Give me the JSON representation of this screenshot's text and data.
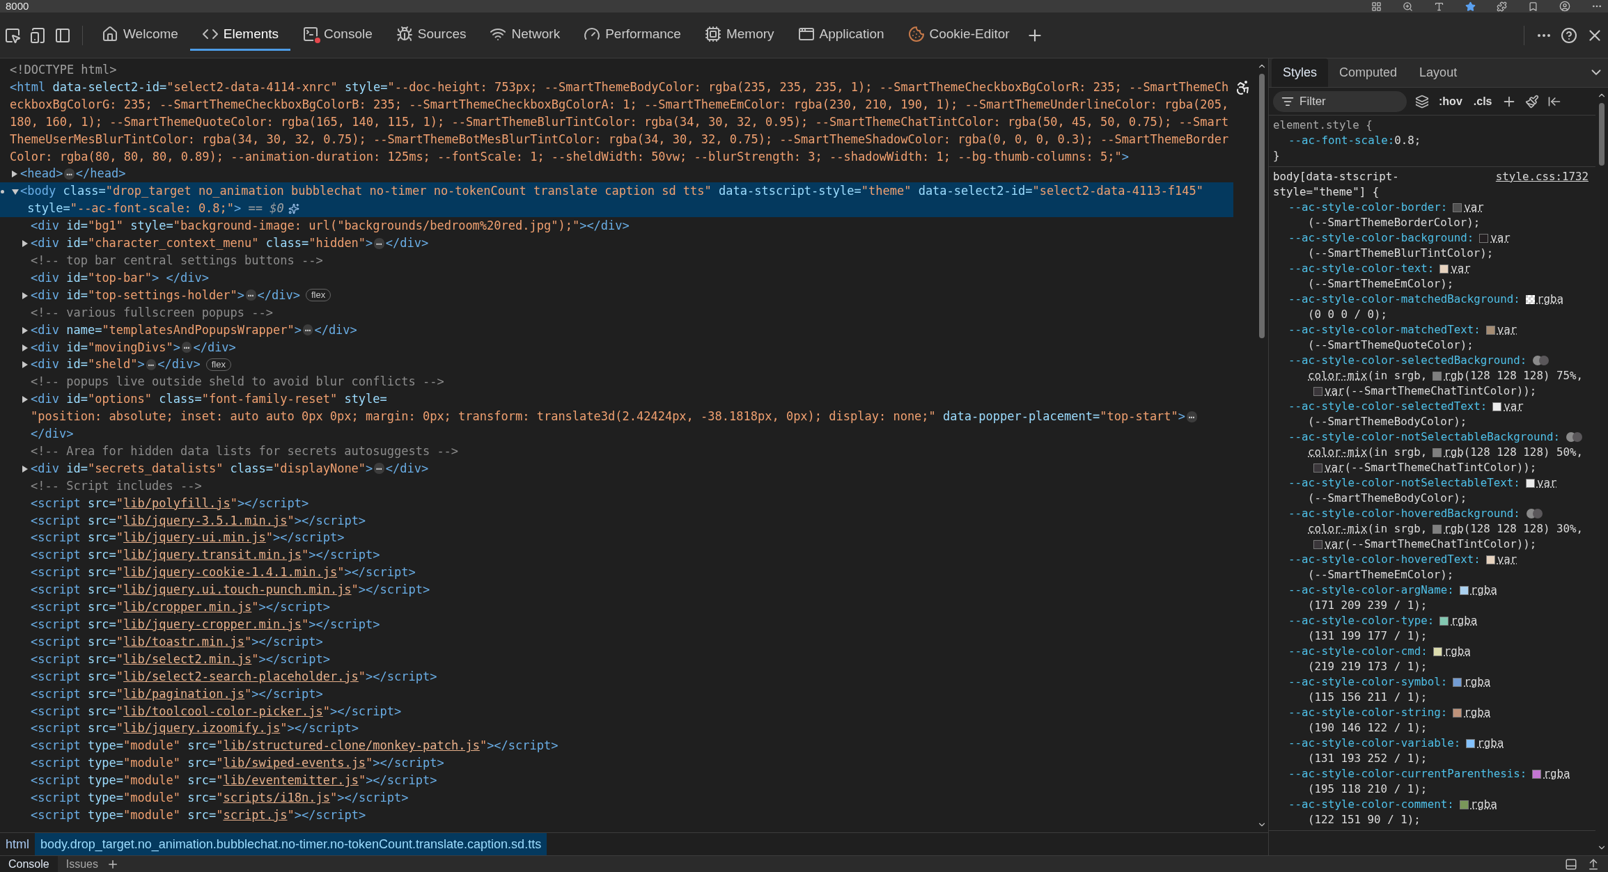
{
  "address_bar": {
    "text": "8000"
  },
  "devtools_tabs": [
    {
      "label": "Welcome",
      "selected": false,
      "has_errors": false
    },
    {
      "label": "Elements",
      "selected": true,
      "has_errors": false
    },
    {
      "label": "Console",
      "selected": false,
      "has_errors": true
    },
    {
      "label": "Sources",
      "selected": false,
      "has_errors": false
    },
    {
      "label": "Network",
      "selected": false,
      "has_errors": false
    },
    {
      "label": "Performance",
      "selected": false,
      "has_errors": false
    },
    {
      "label": "Memory",
      "selected": false,
      "has_errors": false
    },
    {
      "label": "Application",
      "selected": false,
      "has_errors": false
    },
    {
      "label": "Cookie-Editor",
      "selected": false,
      "has_errors": false
    }
  ],
  "dom_tree": [
    {
      "selected": false,
      "parts": [
        {
          "kind": "doctype",
          "text": "<!DOCTYPE html>"
        }
      ]
    },
    {
      "selected": false,
      "parts": [
        {
          "kind": "tag",
          "text": "<html"
        },
        {
          "kind": "attr",
          "text": " data-select2-id="
        },
        {
          "kind": "val",
          "text": "\"select2-data-4114-xnrc\""
        },
        {
          "kind": "attr",
          "text": " style="
        },
        {
          "kind": "val",
          "text": "\"--doc-height: 753px; --SmartThemeBodyColor: rgba(235, 235, 235, 1); --SmartThemeCheckboxBgColorR: 235; --SmartThemeCheckboxBgColorG: 235; --SmartThemeCheckboxBgColorB: 235; --SmartThemeCheckboxBgColorA: 1; --SmartThemeEmColor: rgba(230, 210, 190, 1); --SmartThemeUnderlineColor: rgba(205, 180, 160, 1); --SmartThemeQuoteColor: rgba(165, 140, 115, 1); --SmartThemeBlurTintColor: rgba(34, 30, 32, 0.95); --SmartThemeChatTintColor: rgba(50, 45, 50, 0.75); --SmartThemeUserMesBlurTintColor: rgba(34, 30, 32, 0.75); --SmartThemeBotMesBlurTintColor: rgba(34, 30, 32, 0.75); --SmartThemeShadowColor: rgba(0, 0, 0, 0.3); --SmartThemeBorderColor: rgba(80, 80, 80, 0.89); --animation-duration: 125ms; --fontScale: 1; --sheldWidth: 50vw; --blurStrength: 3; --shadowWidth: 1; --bg-thumb-columns: 5;\""
        },
        {
          "kind": "tag",
          "text": ">"
        }
      ],
      "children": [
        {
          "selected": false,
          "expanded": false,
          "parts": [
            {
              "kind": "tag",
              "text": "<head>"
            },
            {
              "kind": "more",
              "text": "⋯"
            },
            {
              "kind": "tag",
              "text": "</head>"
            }
          ]
        },
        {
          "selected": true,
          "expanded": true,
          "parts": [
            {
              "kind": "tag",
              "text": "<body"
            },
            {
              "kind": "attr",
              "text": " class="
            },
            {
              "kind": "val",
              "text": "\"drop_target no_animation bubblechat no-timer no-tokenCount translate caption sd tts\""
            },
            {
              "kind": "attr",
              "text": " data-stscript-style="
            },
            {
              "kind": "val",
              "text": "\"theme\""
            },
            {
              "kind": "attr",
              "text": " data-select2-id="
            },
            {
              "kind": "val",
              "text": "\"select2-data-4113-f145\""
            },
            {
              "kind": "attr",
              "text": " style="
            },
            {
              "kind": "val",
              "text": "\"--ac-font-scale: 0.8;\""
            },
            {
              "kind": "tag",
              "text": ">"
            },
            {
              "kind": "hint",
              "text": " == $0"
            }
          ],
          "children": [
            {
              "selected": false,
              "parts": [
                {
                  "kind": "tag",
                  "text": "<div"
                },
                {
                  "kind": "attr",
                  "text": " id="
                },
                {
                  "kind": "val",
                  "text": "\"bg1\""
                },
                {
                  "kind": "attr",
                  "text": " style="
                },
                {
                  "kind": "val",
                  "text": "\"background-image: url(\"backgrounds/bedroom%20red.jpg\");\""
                },
                {
                  "kind": "tag",
                  "text": "></div>"
                }
              ]
            },
            {
              "selected": false,
              "expanded": false,
              "parts": [
                {
                  "kind": "tag",
                  "text": "<div"
                },
                {
                  "kind": "attr",
                  "text": " id="
                },
                {
                  "kind": "val",
                  "text": "\"character_context_menu\""
                },
                {
                  "kind": "attr",
                  "text": " class="
                },
                {
                  "kind": "val",
                  "text": "\"hidden\""
                },
                {
                  "kind": "tag",
                  "text": ">"
                },
                {
                  "kind": "more",
                  "text": "⋯"
                },
                {
                  "kind": "tag",
                  "text": "</div>"
                }
              ]
            },
            {
              "selected": false,
              "parts": [
                {
                  "kind": "comment",
                  "text": "<!-- top bar central settings buttons -->"
                }
              ]
            },
            {
              "selected": false,
              "parts": [
                {
                  "kind": "tag",
                  "text": "<div"
                },
                {
                  "kind": "attr",
                  "text": " id="
                },
                {
                  "kind": "val",
                  "text": "\"top-bar\""
                },
                {
                  "kind": "tag",
                  "text": "> </div>"
                }
              ]
            },
            {
              "selected": false,
              "expanded": false,
              "parts": [
                {
                  "kind": "tag",
                  "text": "<div"
                },
                {
                  "kind": "attr",
                  "text": " id="
                },
                {
                  "kind": "val",
                  "text": "\"top-settings-holder\""
                },
                {
                  "kind": "tag",
                  "text": ">"
                },
                {
                  "kind": "more",
                  "text": "⋯"
                },
                {
                  "kind": "tag",
                  "text": "</div>"
                },
                {
                  "kind": "badge",
                  "text": "flex"
                }
              ]
            },
            {
              "selected": false,
              "parts": [
                {
                  "kind": "comment",
                  "text": "<!-- various fullscreen popups -->"
                }
              ]
            },
            {
              "selected": false,
              "expanded": false,
              "parts": [
                {
                  "kind": "tag",
                  "text": "<div"
                },
                {
                  "kind": "attr",
                  "text": " name="
                },
                {
                  "kind": "val",
                  "text": "\"templatesAndPopupsWrapper\""
                },
                {
                  "kind": "tag",
                  "text": ">"
                },
                {
                  "kind": "more",
                  "text": "⋯"
                },
                {
                  "kind": "tag",
                  "text": "</div>"
                }
              ]
            },
            {
              "selected": false,
              "expanded": false,
              "parts": [
                {
                  "kind": "tag",
                  "text": "<div"
                },
                {
                  "kind": "attr",
                  "text": " id="
                },
                {
                  "kind": "val",
                  "text": "\"movingDivs\""
                },
                {
                  "kind": "tag",
                  "text": ">"
                },
                {
                  "kind": "more",
                  "text": "⋯"
                },
                {
                  "kind": "tag",
                  "text": "</div>"
                }
              ]
            },
            {
              "selected": false,
              "expanded": false,
              "parts": [
                {
                  "kind": "tag",
                  "text": "<div"
                },
                {
                  "kind": "attr",
                  "text": " id="
                },
                {
                  "kind": "val",
                  "text": "\"sheld\""
                },
                {
                  "kind": "tag",
                  "text": ">"
                },
                {
                  "kind": "more",
                  "text": "⋯"
                },
                {
                  "kind": "tag",
                  "text": "</div>"
                },
                {
                  "kind": "badge",
                  "text": "flex"
                }
              ]
            },
            {
              "selected": false,
              "parts": [
                {
                  "kind": "comment",
                  "text": "<!-- popups live outside sheld to avoid blur conflicts -->"
                }
              ]
            },
            {
              "selected": false,
              "expanded": false,
              "parts": [
                {
                  "kind": "tag",
                  "text": "<div"
                },
                {
                  "kind": "attr",
                  "text": " id="
                },
                {
                  "kind": "val",
                  "text": "\"options\""
                },
                {
                  "kind": "attr",
                  "text": " class="
                },
                {
                  "kind": "val",
                  "text": "\"font-family-reset\""
                },
                {
                  "kind": "attr",
                  "text": " style="
                },
                {
                  "kind": "val",
                  "text": "\"position: absolute; inset: auto auto 0px 0px; margin: 0px; transform: translate3d(2.42424px, -38.1818px, 0px); display: none;\""
                },
                {
                  "kind": "attr",
                  "text": " data-popper-placement="
                },
                {
                  "kind": "val",
                  "text": "\"top-start\""
                },
                {
                  "kind": "tag",
                  "text": ">"
                },
                {
                  "kind": "more",
                  "text": "⋯"
                },
                {
                  "kind": "tag",
                  "text": "</div>"
                }
              ]
            },
            {
              "selected": false,
              "parts": [
                {
                  "kind": "comment",
                  "text": "<!-- Area for hidden data lists for secrets autosuggests -->"
                }
              ]
            },
            {
              "selected": false,
              "expanded": false,
              "parts": [
                {
                  "kind": "tag",
                  "text": "<div"
                },
                {
                  "kind": "attr",
                  "text": " id="
                },
                {
                  "kind": "val",
                  "text": "\"secrets_datalists\""
                },
                {
                  "kind": "attr",
                  "text": " class="
                },
                {
                  "kind": "val",
                  "text": "\"displayNone\""
                },
                {
                  "kind": "tag",
                  "text": ">"
                },
                {
                  "kind": "more",
                  "text": "⋯"
                },
                {
                  "kind": "tag",
                  "text": "</div>"
                }
              ]
            },
            {
              "selected": false,
              "parts": [
                {
                  "kind": "comment",
                  "text": "<!-- Script includes -->"
                }
              ]
            },
            {
              "selected": false,
              "parts": [
                {
                  "kind": "tag",
                  "text": "<script"
                },
                {
                  "kind": "attr",
                  "text": " src="
                },
                {
                  "kind": "val",
                  "text": "\""
                },
                {
                  "kind": "link",
                  "text": "lib/polyfill.js"
                },
                {
                  "kind": "val",
                  "text": "\""
                },
                {
                  "kind": "tag",
                  "text": "></script>"
                }
              ]
            },
            {
              "selected": false,
              "parts": [
                {
                  "kind": "tag",
                  "text": "<script"
                },
                {
                  "kind": "attr",
                  "text": " src="
                },
                {
                  "kind": "val",
                  "text": "\""
                },
                {
                  "kind": "link",
                  "text": "lib/jquery-3.5.1.min.js"
                },
                {
                  "kind": "val",
                  "text": "\""
                },
                {
                  "kind": "tag",
                  "text": "></script>"
                }
              ]
            },
            {
              "selected": false,
              "parts": [
                {
                  "kind": "tag",
                  "text": "<script"
                },
                {
                  "kind": "attr",
                  "text": " src="
                },
                {
                  "kind": "val",
                  "text": "\""
                },
                {
                  "kind": "link",
                  "text": "lib/jquery-ui.min.js"
                },
                {
                  "kind": "val",
                  "text": "\""
                },
                {
                  "kind": "tag",
                  "text": "></script>"
                }
              ]
            },
            {
              "selected": false,
              "parts": [
                {
                  "kind": "tag",
                  "text": "<script"
                },
                {
                  "kind": "attr",
                  "text": " src="
                },
                {
                  "kind": "val",
                  "text": "\""
                },
                {
                  "kind": "link",
                  "text": "lib/jquery.transit.min.js"
                },
                {
                  "kind": "val",
                  "text": "\""
                },
                {
                  "kind": "tag",
                  "text": "></script>"
                }
              ]
            },
            {
              "selected": false,
              "parts": [
                {
                  "kind": "tag",
                  "text": "<script"
                },
                {
                  "kind": "attr",
                  "text": " src="
                },
                {
                  "kind": "val",
                  "text": "\""
                },
                {
                  "kind": "link",
                  "text": "lib/jquery-cookie-1.4.1.min.js"
                },
                {
                  "kind": "val",
                  "text": "\""
                },
                {
                  "kind": "tag",
                  "text": "></script>"
                }
              ]
            },
            {
              "selected": false,
              "parts": [
                {
                  "kind": "tag",
                  "text": "<script"
                },
                {
                  "kind": "attr",
                  "text": " src="
                },
                {
                  "kind": "val",
                  "text": "\""
                },
                {
                  "kind": "link",
                  "text": "lib/jquery.ui.touch-punch.min.js"
                },
                {
                  "kind": "val",
                  "text": "\""
                },
                {
                  "kind": "tag",
                  "text": "></script>"
                }
              ]
            },
            {
              "selected": false,
              "parts": [
                {
                  "kind": "tag",
                  "text": "<script"
                },
                {
                  "kind": "attr",
                  "text": " src="
                },
                {
                  "kind": "val",
                  "text": "\""
                },
                {
                  "kind": "link",
                  "text": "lib/cropper.min.js"
                },
                {
                  "kind": "val",
                  "text": "\""
                },
                {
                  "kind": "tag",
                  "text": "></script>"
                }
              ]
            },
            {
              "selected": false,
              "parts": [
                {
                  "kind": "tag",
                  "text": "<script"
                },
                {
                  "kind": "attr",
                  "text": " src="
                },
                {
                  "kind": "val",
                  "text": "\""
                },
                {
                  "kind": "link",
                  "text": "lib/jquery-cropper.min.js"
                },
                {
                  "kind": "val",
                  "text": "\""
                },
                {
                  "kind": "tag",
                  "text": "></script>"
                }
              ]
            },
            {
              "selected": false,
              "parts": [
                {
                  "kind": "tag",
                  "text": "<script"
                },
                {
                  "kind": "attr",
                  "text": " src="
                },
                {
                  "kind": "val",
                  "text": "\""
                },
                {
                  "kind": "link",
                  "text": "lib/toastr.min.js"
                },
                {
                  "kind": "val",
                  "text": "\""
                },
                {
                  "kind": "tag",
                  "text": "></script>"
                }
              ]
            },
            {
              "selected": false,
              "parts": [
                {
                  "kind": "tag",
                  "text": "<script"
                },
                {
                  "kind": "attr",
                  "text": " src="
                },
                {
                  "kind": "val",
                  "text": "\""
                },
                {
                  "kind": "link",
                  "text": "lib/select2.min.js"
                },
                {
                  "kind": "val",
                  "text": "\""
                },
                {
                  "kind": "tag",
                  "text": "></script>"
                }
              ]
            },
            {
              "selected": false,
              "parts": [
                {
                  "kind": "tag",
                  "text": "<script"
                },
                {
                  "kind": "attr",
                  "text": " src="
                },
                {
                  "kind": "val",
                  "text": "\""
                },
                {
                  "kind": "link",
                  "text": "lib/select2-search-placeholder.js"
                },
                {
                  "kind": "val",
                  "text": "\""
                },
                {
                  "kind": "tag",
                  "text": "></script>"
                }
              ]
            },
            {
              "selected": false,
              "parts": [
                {
                  "kind": "tag",
                  "text": "<script"
                },
                {
                  "kind": "attr",
                  "text": " src="
                },
                {
                  "kind": "val",
                  "text": "\""
                },
                {
                  "kind": "link",
                  "text": "lib/pagination.js"
                },
                {
                  "kind": "val",
                  "text": "\""
                },
                {
                  "kind": "tag",
                  "text": "></script>"
                }
              ]
            },
            {
              "selected": false,
              "parts": [
                {
                  "kind": "tag",
                  "text": "<script"
                },
                {
                  "kind": "attr",
                  "text": " src="
                },
                {
                  "kind": "val",
                  "text": "\""
                },
                {
                  "kind": "link",
                  "text": "lib/toolcool-color-picker.js"
                },
                {
                  "kind": "val",
                  "text": "\""
                },
                {
                  "kind": "tag",
                  "text": "></script>"
                }
              ]
            },
            {
              "selected": false,
              "parts": [
                {
                  "kind": "tag",
                  "text": "<script"
                },
                {
                  "kind": "attr",
                  "text": " src="
                },
                {
                  "kind": "val",
                  "text": "\""
                },
                {
                  "kind": "link",
                  "text": "lib/jquery.izoomify.js"
                },
                {
                  "kind": "val",
                  "text": "\""
                },
                {
                  "kind": "tag",
                  "text": "></script>"
                }
              ]
            },
            {
              "selected": false,
              "parts": [
                {
                  "kind": "tag",
                  "text": "<script"
                },
                {
                  "kind": "attr",
                  "text": " type="
                },
                {
                  "kind": "val",
                  "text": "\"module\""
                },
                {
                  "kind": "attr",
                  "text": " src="
                },
                {
                  "kind": "val",
                  "text": "\""
                },
                {
                  "kind": "link",
                  "text": "lib/structured-clone/monkey-patch.js"
                },
                {
                  "kind": "val",
                  "text": "\""
                },
                {
                  "kind": "tag",
                  "text": "></script>"
                }
              ]
            },
            {
              "selected": false,
              "parts": [
                {
                  "kind": "tag",
                  "text": "<script"
                },
                {
                  "kind": "attr",
                  "text": " type="
                },
                {
                  "kind": "val",
                  "text": "\"module\""
                },
                {
                  "kind": "attr",
                  "text": " src="
                },
                {
                  "kind": "val",
                  "text": "\""
                },
                {
                  "kind": "link",
                  "text": "lib/swiped-events.js"
                },
                {
                  "kind": "val",
                  "text": "\""
                },
                {
                  "kind": "tag",
                  "text": "></script>"
                }
              ]
            },
            {
              "selected": false,
              "parts": [
                {
                  "kind": "tag",
                  "text": "<script"
                },
                {
                  "kind": "attr",
                  "text": " type="
                },
                {
                  "kind": "val",
                  "text": "\"module\""
                },
                {
                  "kind": "attr",
                  "text": " src="
                },
                {
                  "kind": "val",
                  "text": "\""
                },
                {
                  "kind": "link",
                  "text": "lib/eventemitter.js"
                },
                {
                  "kind": "val",
                  "text": "\""
                },
                {
                  "kind": "tag",
                  "text": "></script>"
                }
              ]
            },
            {
              "selected": false,
              "parts": [
                {
                  "kind": "tag",
                  "text": "<script"
                },
                {
                  "kind": "attr",
                  "text": " type="
                },
                {
                  "kind": "val",
                  "text": "\"module\""
                },
                {
                  "kind": "attr",
                  "text": " src="
                },
                {
                  "kind": "val",
                  "text": "\""
                },
                {
                  "kind": "link",
                  "text": "scripts/i18n.js"
                },
                {
                  "kind": "val",
                  "text": "\""
                },
                {
                  "kind": "tag",
                  "text": "></script>"
                }
              ]
            },
            {
              "selected": false,
              "parts": [
                {
                  "kind": "tag",
                  "text": "<script"
                },
                {
                  "kind": "attr",
                  "text": " type="
                },
                {
                  "kind": "val",
                  "text": "\"module\""
                },
                {
                  "kind": "attr",
                  "text": " src="
                },
                {
                  "kind": "val",
                  "text": "\""
                },
                {
                  "kind": "link",
                  "text": "script.js"
                },
                {
                  "kind": "val",
                  "text": "\""
                },
                {
                  "kind": "tag",
                  "text": "></script>"
                }
              ]
            }
          ]
        }
      ]
    }
  ],
  "breadcrumbs": [
    {
      "label": "html",
      "selected": false
    },
    {
      "label": "body.drop_target.no_animation.bubblechat.no-timer.no-tokenCount.translate.caption.sd.tts",
      "selected": true
    }
  ],
  "styles_panel": {
    "tabs": [
      {
        "label": "Styles",
        "selected": true
      },
      {
        "label": "Computed",
        "selected": false
      },
      {
        "label": "Layout",
        "selected": false
      }
    ],
    "filter": {
      "placeholder": "Filter"
    },
    "toolbar_buttons": [
      ":hov",
      ".cls"
    ],
    "rules": [
      {
        "selector": "element.style {",
        "close": "}",
        "declarations": [
          {
            "name": "--ac-font-scale:",
            "value": [
              {
                "kind": "text",
                "text": "0.8;"
              }
            ]
          }
        ]
      },
      {
        "selector": "body[data-stscript-style=\"theme\"] {",
        "source": "style.css:1732",
        "declarations": [
          {
            "name": "--ac-style-color-border:",
            "value": [
              {
                "kind": "swatch",
                "color": "#505050"
              },
              {
                "kind": "fn",
                "text": "var"
              },
              {
                "kind": "text",
                "text": "(--SmartThemeBorderColor);"
              }
            ]
          },
          {
            "name": "--ac-style-color-background:",
            "value": [
              {
                "kind": "swatch",
                "color": "#221e20"
              },
              {
                "kind": "fn",
                "text": "var"
              },
              {
                "kind": "text",
                "text": "(--SmartThemeBlurTintColor);"
              }
            ]
          },
          {
            "name": "--ac-style-color-text:",
            "value": [
              {
                "kind": "swatch",
                "color": "#e6d2be"
              },
              {
                "kind": "fn",
                "text": "var"
              },
              {
                "kind": "text",
                "text": "(--SmartThemeEmColor);"
              }
            ]
          },
          {
            "name": "--ac-style-color-matchedBackground:",
            "value": [
              {
                "kind": "checker"
              },
              {
                "kind": "fn",
                "text": "rgba"
              },
              {
                "kind": "text",
                "text": "(0 0 0 / 0);"
              }
            ]
          },
          {
            "name": "--ac-style-color-matchedText:",
            "value": [
              {
                "kind": "swatch",
                "color": "#a58c73"
              },
              {
                "kind": "fn",
                "text": "var"
              },
              {
                "kind": "text",
                "text": "(--SmartThemeQuoteColor);"
              }
            ]
          },
          {
            "name": "--ac-style-color-selectedBackground:",
            "value": [
              {
                "kind": "mix"
              },
              {
                "kind": "fn",
                "text": "color-mix"
              },
              {
                "kind": "text",
                "text": "(in srgb,"
              },
              {
                "kind": "swatch",
                "color": "#808080"
              },
              {
                "kind": "fn",
                "text": "rgb"
              },
              {
                "kind": "text",
                "text": "(128 128 128) 75%,"
              },
              {
                "kind": "swatch",
                "color": "#3a363a"
              },
              {
                "kind": "fn",
                "text": "var"
              },
              {
                "kind": "text",
                "text": "(--SmartThemeChatTintColor));"
              }
            ]
          },
          {
            "name": "--ac-style-color-selectedText:",
            "value": [
              {
                "kind": "swatch",
                "color": "#ebebeb"
              },
              {
                "kind": "fn",
                "text": "var"
              },
              {
                "kind": "text",
                "text": "(--SmartThemeBodyColor);"
              }
            ]
          },
          {
            "name": "--ac-style-color-notSelectableBackground:",
            "value": [
              {
                "kind": "mix"
              },
              {
                "kind": "fn",
                "text": "color-mix"
              },
              {
                "kind": "text",
                "text": "(in srgb,"
              },
              {
                "kind": "swatch",
                "color": "#808080"
              },
              {
                "kind": "fn",
                "text": "rgb"
              },
              {
                "kind": "text",
                "text": "(128 128 128) 50%,"
              },
              {
                "kind": "swatch",
                "color": "#3a363a"
              },
              {
                "kind": "fn",
                "text": "var"
              },
              {
                "kind": "text",
                "text": "(--SmartThemeChatTintColor));"
              }
            ]
          },
          {
            "name": "--ac-style-color-notSelectableText:",
            "value": [
              {
                "kind": "swatch",
                "color": "#ebebeb"
              },
              {
                "kind": "fn",
                "text": "var"
              },
              {
                "kind": "text",
                "text": "(--SmartThemeBodyColor);"
              }
            ]
          },
          {
            "name": "--ac-style-color-hoveredBackground:",
            "value": [
              {
                "kind": "mix"
              },
              {
                "kind": "fn",
                "text": "color-mix"
              },
              {
                "kind": "text",
                "text": "(in srgb,"
              },
              {
                "kind": "swatch",
                "color": "#808080"
              },
              {
                "kind": "fn",
                "text": "rgb"
              },
              {
                "kind": "text",
                "text": "(128 128 128) 30%,"
              },
              {
                "kind": "swatch",
                "color": "#3a363a"
              },
              {
                "kind": "fn",
                "text": "var"
              },
              {
                "kind": "text",
                "text": "(--SmartThemeChatTintColor));"
              }
            ]
          },
          {
            "name": "--ac-style-color-hoveredText:",
            "value": [
              {
                "kind": "swatch",
                "color": "#e6d2be"
              },
              {
                "kind": "fn",
                "text": "var"
              },
              {
                "kind": "text",
                "text": "(--SmartThemeEmColor);"
              }
            ]
          },
          {
            "name": "--ac-style-color-argName:",
            "value": [
              {
                "kind": "swatch",
                "color": "#abd1ef"
              },
              {
                "kind": "fn",
                "text": "rgba"
              },
              {
                "kind": "text",
                "text": "(171 209 239 / 1);"
              }
            ]
          },
          {
            "name": "--ac-style-color-type:",
            "value": [
              {
                "kind": "swatch",
                "color": "#83c7b1"
              },
              {
                "kind": "fn",
                "text": "rgba"
              },
              {
                "kind": "text",
                "text": "(131 199 177 / 1);"
              }
            ]
          },
          {
            "name": "--ac-style-color-cmd:",
            "value": [
              {
                "kind": "swatch",
                "color": "#dbdbad"
              },
              {
                "kind": "fn",
                "text": "rgba"
              },
              {
                "kind": "text",
                "text": "(219 219 173 / 1);"
              }
            ]
          },
          {
            "name": "--ac-style-color-symbol:",
            "value": [
              {
                "kind": "swatch",
                "color": "#739cd3"
              },
              {
                "kind": "fn",
                "text": "rgba"
              },
              {
                "kind": "text",
                "text": "(115 156 211 / 1);"
              }
            ]
          },
          {
            "name": "--ac-style-color-string:",
            "value": [
              {
                "kind": "swatch",
                "color": "#be927a"
              },
              {
                "kind": "fn",
                "text": "rgba"
              },
              {
                "kind": "text",
                "text": "(190 146 122 / 1);"
              }
            ]
          },
          {
            "name": "--ac-style-color-variable:",
            "value": [
              {
                "kind": "swatch",
                "color": "#83c1fc"
              },
              {
                "kind": "fn",
                "text": "rgba"
              },
              {
                "kind": "text",
                "text": "(131 193 252 / 1);"
              }
            ]
          },
          {
            "name": "--ac-style-color-currentParenthesis:",
            "value": [
              {
                "kind": "swatch",
                "color": "#c376d2"
              },
              {
                "kind": "fn",
                "text": "rgba"
              },
              {
                "kind": "text",
                "text": "(195 118 210 / 1);"
              }
            ]
          },
          {
            "name": "--ac-style-color-comment:",
            "value": [
              {
                "kind": "swatch",
                "color": "#7a975a"
              },
              {
                "kind": "fn",
                "text": "rgba"
              },
              {
                "kind": "text",
                "text": "(122 151 90 / 1);"
              }
            ]
          }
        ]
      }
    ]
  },
  "drawer_tabs": [
    {
      "label": "Console",
      "selected": true
    },
    {
      "label": "Issues",
      "selected": false
    }
  ]
}
